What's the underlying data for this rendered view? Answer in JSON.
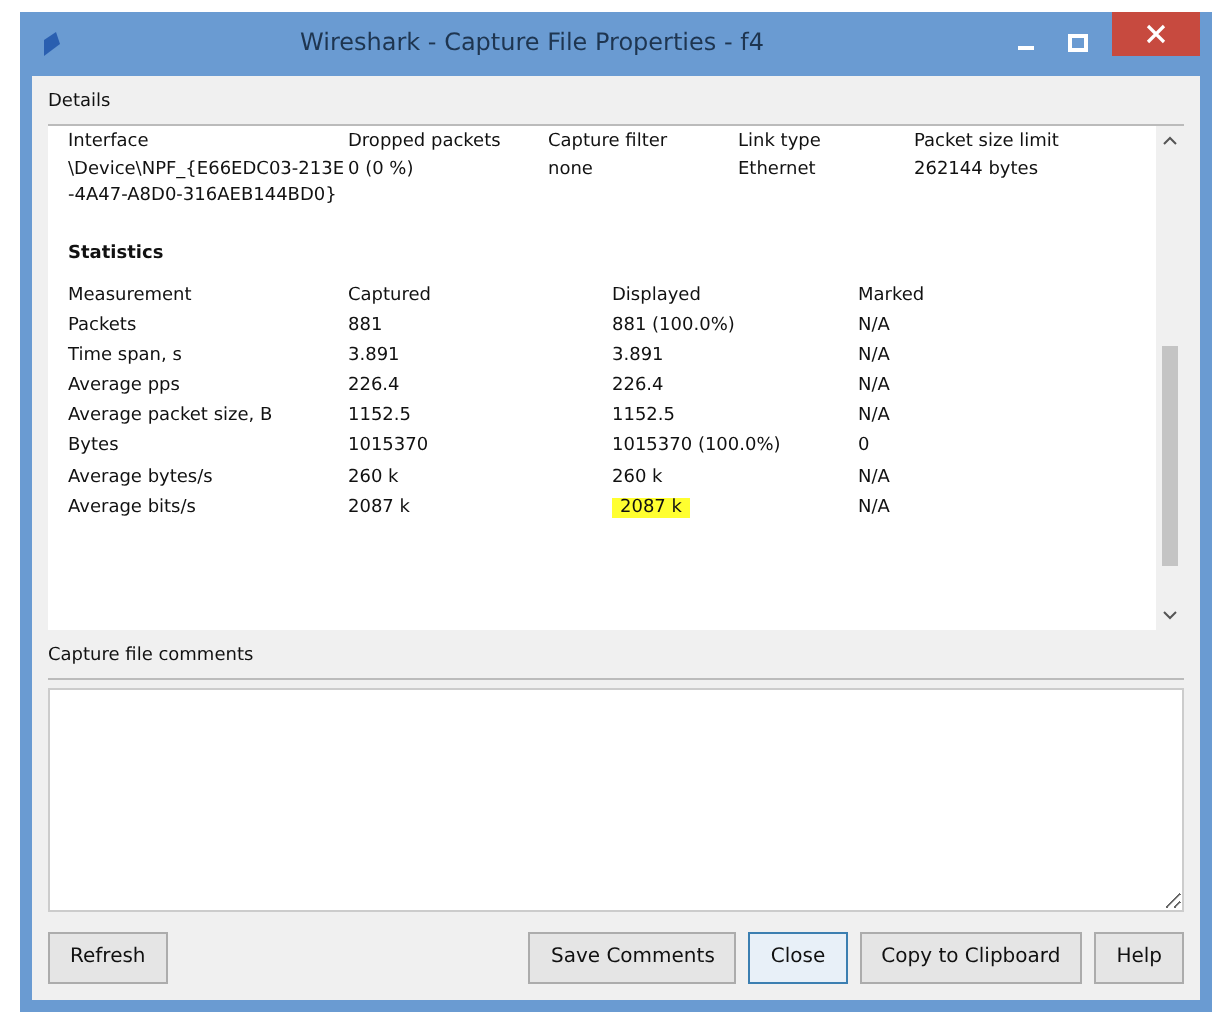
{
  "window": {
    "title": "Wireshark - Capture File Properties - f4"
  },
  "details": {
    "header": "Details",
    "columns": [
      "Interface",
      "Dropped packets",
      "Capture filter",
      "Link type",
      "Packet size limit"
    ],
    "row": [
      "\\Device\\NPF_{E66EDC03-213E-4A47-A8D0-316AEB144BD0}",
      "0 (0 %)",
      "none",
      "Ethernet",
      "262144 bytes"
    ]
  },
  "statistics": {
    "heading": "Statistics",
    "columns": [
      "Measurement",
      "Captured",
      "Displayed",
      "Marked"
    ],
    "rows": [
      {
        "cells": [
          "Packets",
          "881",
          "881 (100.0%)",
          "N/A"
        ],
        "highlighted": false
      },
      {
        "cells": [
          "Time span, s",
          "3.891",
          "3.891",
          "N/A"
        ],
        "highlighted": false
      },
      {
        "cells": [
          "Average pps",
          "226.4",
          "226.4",
          "N/A"
        ],
        "highlighted": false
      },
      {
        "cells": [
          "Average packet size, B",
          "1152.5",
          "1152.5",
          "N/A"
        ],
        "highlighted": false
      },
      {
        "cells": [
          "Bytes",
          "1015370",
          "1015370 (100.0%)",
          "0"
        ],
        "highlighted": false
      },
      {
        "cells": [
          "Average bytes/s",
          "260 k",
          "260 k",
          "N/A"
        ],
        "highlighted": false
      },
      {
        "cells": [
          "Average bits/s",
          "2087 k",
          "2087 k",
          "N/A"
        ],
        "highlighted": true
      }
    ]
  },
  "comments": {
    "label": "Capture file comments"
  },
  "buttons": [
    {
      "label": "Refresh",
      "focused": false
    },
    {
      "label": "Save Comments",
      "focused": false
    },
    {
      "label": "Close",
      "focused": true
    },
    {
      "label": "Copy to Clipboard",
      "focused": false
    },
    {
      "label": "Help",
      "focused": false
    }
  ]
}
